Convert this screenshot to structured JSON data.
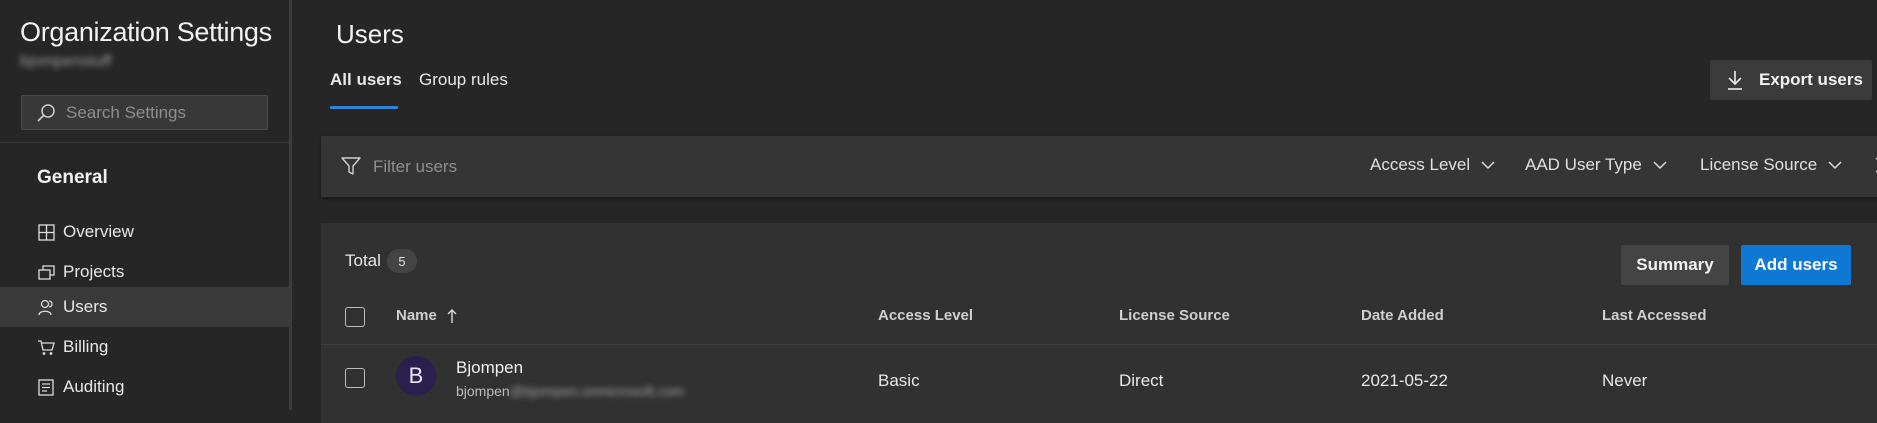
{
  "sidebar": {
    "title": "Organization Settings",
    "org_name": "bjompenstuff",
    "search_placeholder": "Search Settings",
    "group_header": "General",
    "items": [
      {
        "label": "Overview",
        "icon": "overview-icon"
      },
      {
        "label": "Projects",
        "icon": "projects-icon"
      },
      {
        "label": "Users",
        "icon": "users-icon",
        "selected": true
      },
      {
        "label": "Billing",
        "icon": "cart-icon"
      },
      {
        "label": "Auditing",
        "icon": "auditing-icon"
      }
    ]
  },
  "header": {
    "title": "Users",
    "tabs": [
      {
        "label": "All users",
        "active": true
      },
      {
        "label": "Group rules",
        "active": false
      }
    ],
    "export_label": "Export users"
  },
  "filters": {
    "placeholder": "Filter users",
    "dropdowns": [
      "Access Level",
      "AAD User Type",
      "License Source"
    ]
  },
  "table": {
    "total_label": "Total",
    "total_count": "5",
    "summary_label": "Summary",
    "add_label": "Add users",
    "columns": [
      "Name",
      "Access Level",
      "License Source",
      "Date Added",
      "Last Accessed"
    ],
    "rows": [
      {
        "avatar_initial": "B",
        "name": "Bjompen",
        "email_visible": "bjompen",
        "email_hidden": "@bjompen.onmicrosoft.com",
        "access_level": "Basic",
        "license_source": "Direct",
        "date_added": "2021-05-22",
        "last_accessed": "Never"
      }
    ]
  },
  "colors": {
    "accent": "#0f78d4",
    "tab_underline": "#2f84d8",
    "avatar_bg": "#2b1f4f"
  }
}
